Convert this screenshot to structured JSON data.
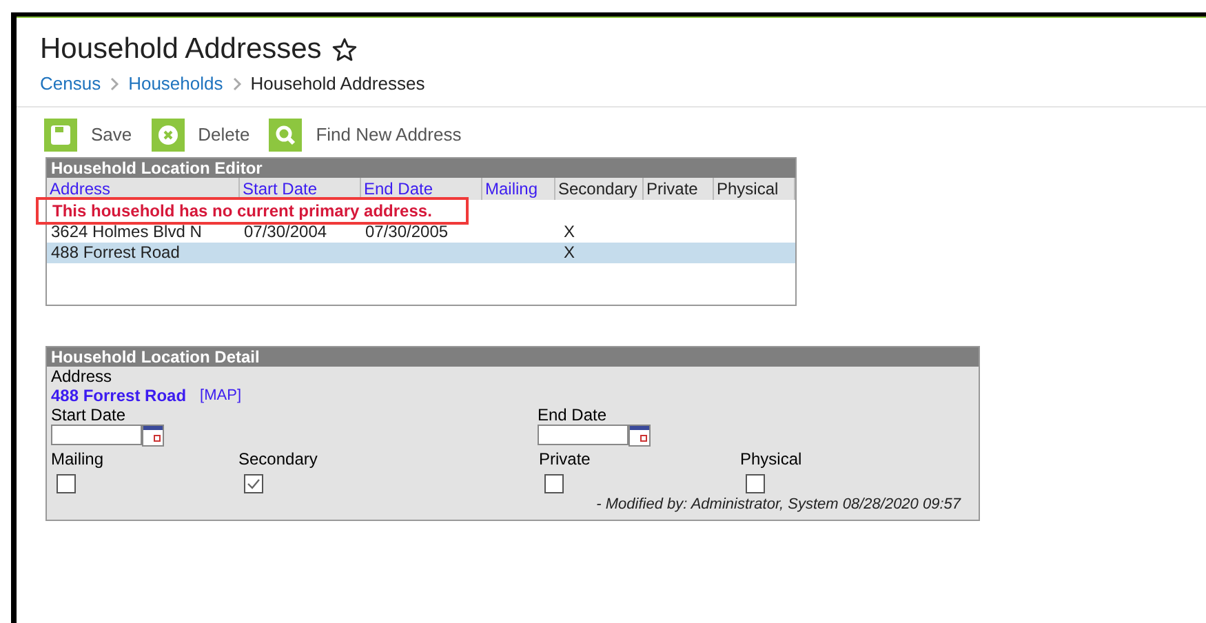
{
  "page": {
    "title": "Household Addresses",
    "favorite": false
  },
  "breadcrumb": [
    {
      "label": "Census",
      "link": true
    },
    {
      "label": "Households",
      "link": true
    },
    {
      "label": "Household Addresses",
      "link": false
    }
  ],
  "toolbar": [
    {
      "label": "Save",
      "kind": "save"
    },
    {
      "label": "Delete",
      "kind": "delete"
    },
    {
      "label": "Find New Address",
      "kind": "search"
    }
  ],
  "editor": {
    "title": "Household Location Editor",
    "columns": [
      {
        "label": "Address",
        "sortable": true
      },
      {
        "label": "Start Date",
        "sortable": true
      },
      {
        "label": "End Date",
        "sortable": true
      },
      {
        "label": "Mailing",
        "sortable": true
      },
      {
        "label": "Secondary",
        "sortable": false
      },
      {
        "label": "Private",
        "sortable": false
      },
      {
        "label": "Physical",
        "sortable": false
      }
    ],
    "warning": "This household has no current primary address.",
    "rows": [
      {
        "selected": false,
        "cells": [
          "3624 Holmes Blvd N",
          "07/30/2004",
          "07/30/2005",
          "",
          "X",
          "",
          ""
        ]
      },
      {
        "selected": true,
        "cells": [
          "488 Forrest Road",
          "",
          "",
          "",
          "X",
          "",
          ""
        ]
      }
    ]
  },
  "detail": {
    "title": "Household Location Detail",
    "address_label": "Address",
    "address": "488 Forrest Road",
    "map_link": "[MAP]",
    "start_label": "Start Date",
    "end_label": "End Date",
    "checkboxes": [
      {
        "label": "Mailing",
        "checked": false
      },
      {
        "label": "Secondary",
        "checked": true
      },
      {
        "label": "Private",
        "checked": false
      },
      {
        "label": "Physical",
        "checked": false
      }
    ],
    "modified": "- Modified by: Administrator, System 08/28/2020 09:57"
  }
}
